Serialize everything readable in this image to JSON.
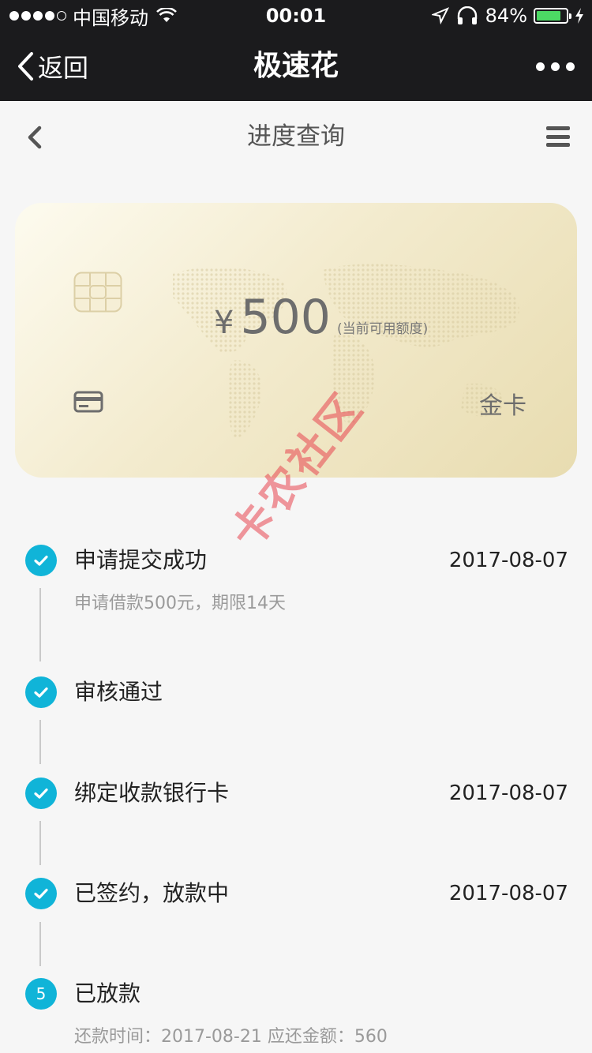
{
  "status_bar": {
    "carrier": "中国移动",
    "time": "00:01",
    "battery": "84%",
    "battery_level": 0.84
  },
  "navbar": {
    "back_label": "返回",
    "title": "极速花"
  },
  "page": {
    "title": "进度查询"
  },
  "card": {
    "currency": "¥",
    "amount": "500",
    "amount_label": "(当前可用额度)",
    "tier": "金卡"
  },
  "watermark": "卡农社区",
  "steps": [
    {
      "marker": "check",
      "title": "申请提交成功",
      "date": "2017-08-07",
      "subtitle": "申请借款500元，期限14天"
    },
    {
      "marker": "check",
      "title": "审核通过",
      "date": "",
      "subtitle": ""
    },
    {
      "marker": "check",
      "title": "绑定收款银行卡",
      "date": "2017-08-07",
      "subtitle": ""
    },
    {
      "marker": "check",
      "title": "已签约，放款中",
      "date": "2017-08-07",
      "subtitle": ""
    },
    {
      "marker": "5",
      "title": "已放款",
      "date": "",
      "subtitle": "还款时间：2017-08-21 应还金额：560"
    }
  ],
  "colors": {
    "accent": "#10b4d8",
    "navbar": "#1b1b1d",
    "battery": "#4cd964",
    "watermark": "#e8444e"
  },
  "icons": [
    "wifi-icon",
    "location-icon",
    "headphones-icon",
    "battery-icon",
    "charging-icon",
    "back-chevron-icon",
    "more-icon",
    "menu-icon",
    "chip-icon",
    "credit-card-icon",
    "check-icon"
  ]
}
